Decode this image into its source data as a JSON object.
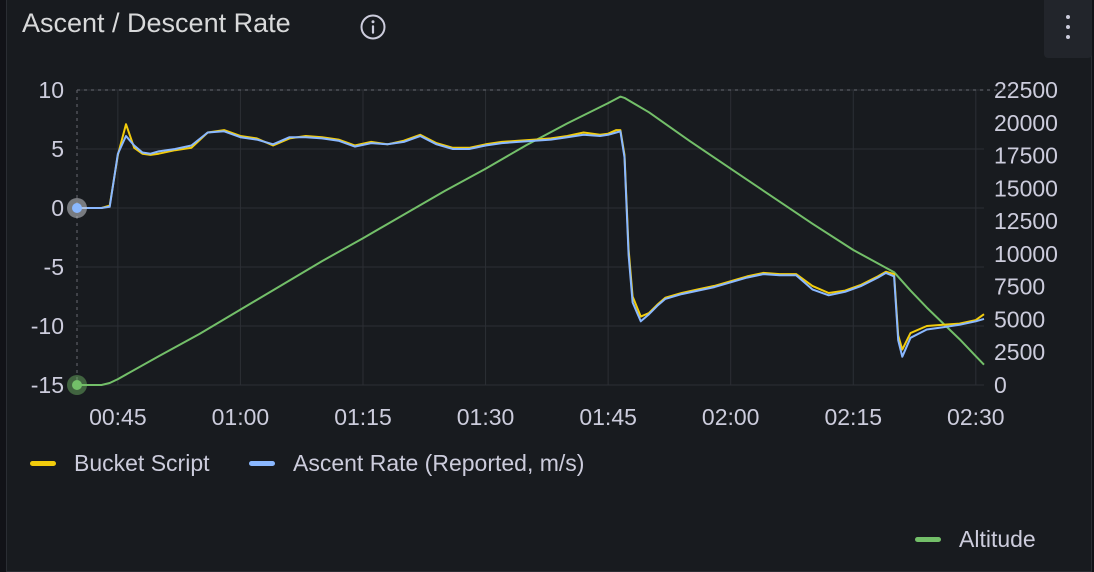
{
  "panel": {
    "title": "Ascent / Descent Rate",
    "info_icon": "info-icon",
    "menu_icon": "kebab-menu-icon"
  },
  "chart_data": {
    "type": "line",
    "x_ticks": [
      "00:45",
      "01:00",
      "01:15",
      "01:30",
      "01:45",
      "02:00",
      "02:15",
      "02:30"
    ],
    "x_range": [
      "00:40",
      "02:31"
    ],
    "y_left": {
      "ticks": [
        10,
        5,
        0,
        -5,
        -10,
        -15
      ],
      "range": [
        -15,
        10
      ]
    },
    "y_right": {
      "ticks": [
        22500,
        20000,
        17500,
        15000,
        12500,
        10000,
        7500,
        5000,
        2500,
        0
      ],
      "range": [
        0,
        22500
      ]
    },
    "grid": true,
    "legend_position": "bottom",
    "series": [
      {
        "name": "Bucket Script",
        "axis": "left",
        "color": "#f2cc0c",
        "points": [
          [
            "00:40",
            0
          ],
          [
            "00:43",
            0
          ],
          [
            "00:44",
            0.2
          ],
          [
            "00:45",
            4.5
          ],
          [
            "00:46",
            7.1
          ],
          [
            "00:47",
            5.1
          ],
          [
            "00:48",
            4.6
          ],
          [
            "00:49",
            4.5
          ],
          [
            "00:50",
            4.6
          ],
          [
            "00:52",
            4.9
          ],
          [
            "00:54",
            5.1
          ],
          [
            "00:56",
            6.4
          ],
          [
            "00:58",
            6.6
          ],
          [
            "01:00",
            6.1
          ],
          [
            "01:02",
            5.9
          ],
          [
            "01:04",
            5.3
          ],
          [
            "01:06",
            5.9
          ],
          [
            "01:08",
            6.1
          ],
          [
            "01:10",
            6.0
          ],
          [
            "01:12",
            5.8
          ],
          [
            "01:14",
            5.3
          ],
          [
            "01:16",
            5.6
          ],
          [
            "01:18",
            5.4
          ],
          [
            "01:20",
            5.7
          ],
          [
            "01:22",
            6.2
          ],
          [
            "01:24",
            5.5
          ],
          [
            "01:26",
            5.1
          ],
          [
            "01:28",
            5.1
          ],
          [
            "01:30",
            5.4
          ],
          [
            "01:32",
            5.6
          ],
          [
            "01:34",
            5.7
          ],
          [
            "01:36",
            5.8
          ],
          [
            "01:38",
            5.9
          ],
          [
            "01:40",
            6.1
          ],
          [
            "01:42",
            6.4
          ],
          [
            "01:44",
            6.2
          ],
          [
            "01:45",
            6.3
          ],
          [
            "01:46",
            6.6
          ],
          [
            "01:46:30",
            6.6
          ],
          [
            "01:47",
            4.5
          ],
          [
            "01:47:30",
            -3.5
          ],
          [
            "01:48",
            -7.5
          ],
          [
            "01:49",
            -9.2
          ],
          [
            "01:50",
            -8.9
          ],
          [
            "01:51",
            -8.2
          ],
          [
            "01:52",
            -7.6
          ],
          [
            "01:54",
            -7.2
          ],
          [
            "01:56",
            -6.9
          ],
          [
            "01:58",
            -6.6
          ],
          [
            "02:00",
            -6.2
          ],
          [
            "02:02",
            -5.8
          ],
          [
            "02:04",
            -5.5
          ],
          [
            "02:06",
            -5.6
          ],
          [
            "02:08",
            -5.6
          ],
          [
            "02:10",
            -6.6
          ],
          [
            "02:12",
            -7.2
          ],
          [
            "02:14",
            -7.0
          ],
          [
            "02:16",
            -6.5
          ],
          [
            "02:18",
            -5.8
          ],
          [
            "02:19",
            -5.4
          ],
          [
            "02:20",
            -5.6
          ],
          [
            "02:20:30",
            -10.8
          ],
          [
            "02:21",
            -12.0
          ],
          [
            "02:22",
            -10.6
          ],
          [
            "02:24",
            -10.0
          ],
          [
            "02:26",
            -9.9
          ],
          [
            "02:28",
            -9.8
          ],
          [
            "02:30",
            -9.5
          ],
          [
            "02:31",
            -9.0
          ]
        ]
      },
      {
        "name": "Ascent Rate (Reported, m/s)",
        "axis": "left",
        "color": "#8ab8ff",
        "points": [
          [
            "00:40",
            0
          ],
          [
            "00:43",
            0
          ],
          [
            "00:44",
            0.1
          ],
          [
            "00:45",
            4.6
          ],
          [
            "00:46",
            6.1
          ],
          [
            "00:47",
            5.3
          ],
          [
            "00:48",
            4.7
          ],
          [
            "00:49",
            4.6
          ],
          [
            "00:50",
            4.8
          ],
          [
            "00:52",
            5.0
          ],
          [
            "00:54",
            5.3
          ],
          [
            "00:56",
            6.4
          ],
          [
            "00:58",
            6.5
          ],
          [
            "01:00",
            6.0
          ],
          [
            "01:02",
            5.8
          ],
          [
            "01:04",
            5.4
          ],
          [
            "01:06",
            6.0
          ],
          [
            "01:08",
            6.0
          ],
          [
            "01:10",
            5.9
          ],
          [
            "01:12",
            5.7
          ],
          [
            "01:14",
            5.2
          ],
          [
            "01:16",
            5.5
          ],
          [
            "01:18",
            5.4
          ],
          [
            "01:20",
            5.6
          ],
          [
            "01:22",
            6.1
          ],
          [
            "01:24",
            5.4
          ],
          [
            "01:26",
            5.0
          ],
          [
            "01:28",
            5.0
          ],
          [
            "01:30",
            5.3
          ],
          [
            "01:32",
            5.5
          ],
          [
            "01:34",
            5.6
          ],
          [
            "01:36",
            5.7
          ],
          [
            "01:38",
            5.8
          ],
          [
            "01:40",
            6.0
          ],
          [
            "01:42",
            6.2
          ],
          [
            "01:44",
            6.1
          ],
          [
            "01:45",
            6.2
          ],
          [
            "01:46",
            6.4
          ],
          [
            "01:46:30",
            6.5
          ],
          [
            "01:47",
            4.3
          ],
          [
            "01:47:30",
            -4.0
          ],
          [
            "01:48",
            -8.0
          ],
          [
            "01:49",
            -9.6
          ],
          [
            "01:50",
            -9.0
          ],
          [
            "01:51",
            -8.3
          ],
          [
            "01:52",
            -7.7
          ],
          [
            "01:54",
            -7.3
          ],
          [
            "01:56",
            -7.0
          ],
          [
            "01:58",
            -6.7
          ],
          [
            "02:00",
            -6.3
          ],
          [
            "02:02",
            -5.9
          ],
          [
            "02:04",
            -5.6
          ],
          [
            "02:06",
            -5.7
          ],
          [
            "02:08",
            -5.7
          ],
          [
            "02:10",
            -6.9
          ],
          [
            "02:12",
            -7.4
          ],
          [
            "02:14",
            -7.1
          ],
          [
            "02:16",
            -6.6
          ],
          [
            "02:18",
            -5.9
          ],
          [
            "02:19",
            -5.5
          ],
          [
            "02:20",
            -5.8
          ],
          [
            "02:20:30",
            -11.2
          ],
          [
            "02:21",
            -12.6
          ],
          [
            "02:22",
            -11.0
          ],
          [
            "02:24",
            -10.3
          ],
          [
            "02:26",
            -10.1
          ],
          [
            "02:28",
            -9.9
          ],
          [
            "02:30",
            -9.6
          ],
          [
            "02:31",
            -9.4
          ]
        ]
      },
      {
        "name": "Altitude",
        "axis": "right",
        "color": "#73bf69",
        "points": [
          [
            "00:40",
            0
          ],
          [
            "00:43",
            0
          ],
          [
            "00:44",
            150
          ],
          [
            "00:45",
            450
          ],
          [
            "00:50",
            2200
          ],
          [
            "00:55",
            3900
          ],
          [
            "01:00",
            5750
          ],
          [
            "01:05",
            7600
          ],
          [
            "01:10",
            9450
          ],
          [
            "01:15",
            11200
          ],
          [
            "01:20",
            13000
          ],
          [
            "01:25",
            14800
          ],
          [
            "01:30",
            16500
          ],
          [
            "01:35",
            18300
          ],
          [
            "01:40",
            19950
          ],
          [
            "01:45",
            21500
          ],
          [
            "01:46:30",
            22000
          ],
          [
            "01:47",
            21900
          ],
          [
            "01:50",
            20800
          ],
          [
            "01:55",
            18600
          ],
          [
            "02:00",
            16500
          ],
          [
            "02:05",
            14400
          ],
          [
            "02:10",
            12300
          ],
          [
            "02:15",
            10300
          ],
          [
            "02:20",
            8600
          ],
          [
            "02:22",
            7200
          ],
          [
            "02:24",
            5900
          ],
          [
            "02:26",
            4700
          ],
          [
            "02:28",
            3500
          ],
          [
            "02:30",
            2200
          ],
          [
            "02:31",
            1550
          ]
        ]
      }
    ]
  }
}
